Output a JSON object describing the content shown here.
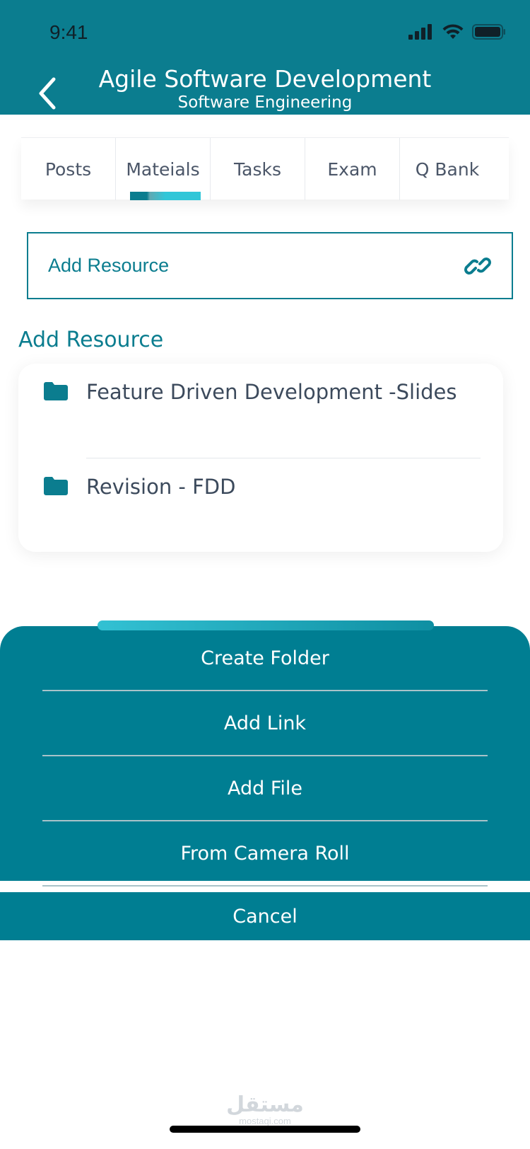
{
  "status_bar": {
    "time": "9:41"
  },
  "header": {
    "title": "Agile Software Development",
    "subtitle": "Software Engineering"
  },
  "tabs": [
    {
      "label": "Posts",
      "active": false
    },
    {
      "label": "Mateials",
      "active": true
    },
    {
      "label": "Tasks",
      "active": false
    },
    {
      "label": "Exam",
      "active": false
    },
    {
      "label": "Q Bank",
      "active": false
    }
  ],
  "add_resource_box": {
    "label": "Add Resource",
    "icon": "link-icon"
  },
  "resources_section": {
    "title": "Add Resource",
    "items": [
      {
        "label": "Feature Driven Development -Slides",
        "icon": "folder-icon"
      },
      {
        "label": "Revision - FDD",
        "icon": "folder-icon"
      }
    ]
  },
  "action_sheet": {
    "items": [
      "Create Folder",
      "Add Link",
      "Add File",
      "From Camera Roll"
    ],
    "cancel_label": "Cancel"
  },
  "watermark": {
    "arabic": "مستقل",
    "latin": "mostaqi.com"
  },
  "colors": {
    "primary": "#0b7d8f",
    "sheet": "#007e92",
    "accent": "#31c6d8",
    "text": "#3c4a5c"
  }
}
